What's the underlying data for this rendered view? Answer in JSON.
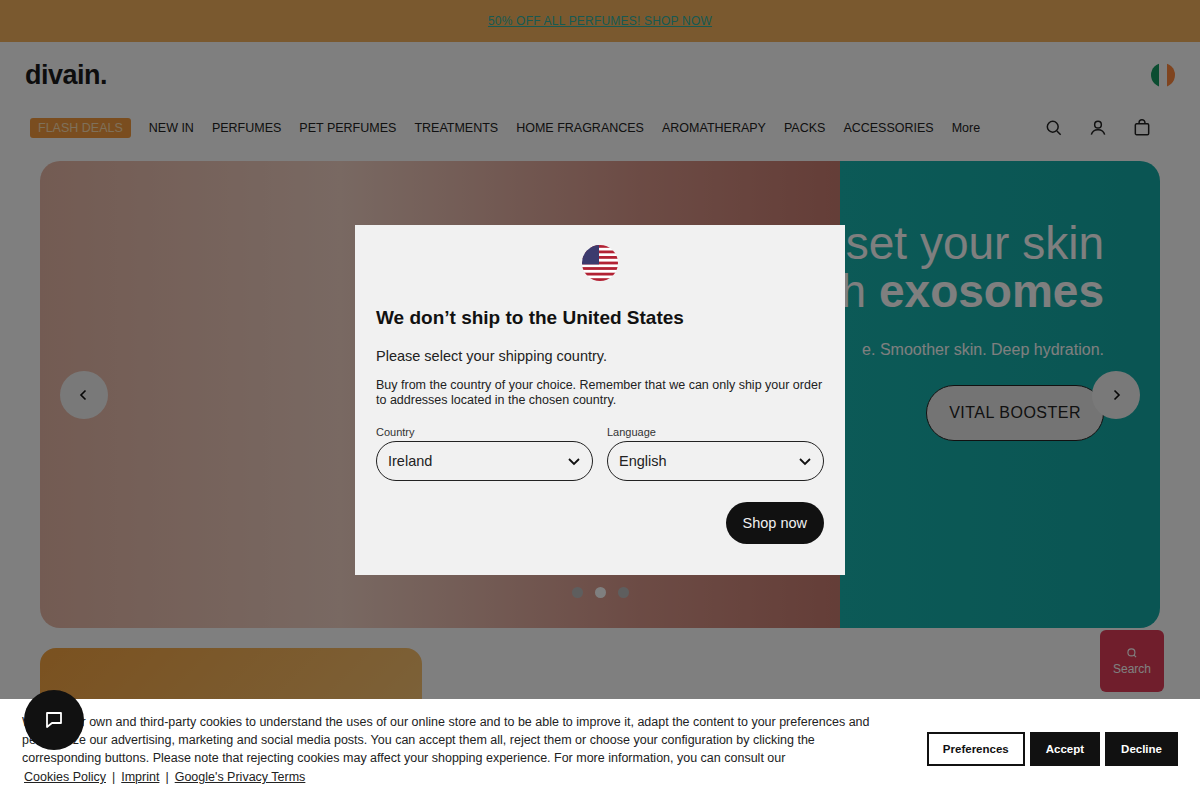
{
  "promo": {
    "text": "50% OFF ALL PERFUMES! SHOP NOW"
  },
  "header": {
    "logo": "divain."
  },
  "nav": {
    "items": [
      {
        "label": "FLASH DEALS",
        "kind": "badge"
      },
      {
        "label": "NEW IN",
        "kind": "link"
      },
      {
        "label": "PERFUMES",
        "kind": "link"
      },
      {
        "label": "PET PERFUMES",
        "kind": "link"
      },
      {
        "label": "TREATMENTS",
        "kind": "link"
      },
      {
        "label": "HOME FRAGRANCES",
        "kind": "link"
      },
      {
        "label": "AROMATHERAPY",
        "kind": "link"
      },
      {
        "label": "PACKS",
        "kind": "link"
      },
      {
        "label": "ACCESSORIES",
        "kind": "link"
      },
      {
        "label": "More",
        "kind": "link"
      }
    ]
  },
  "hero": {
    "title_lines": [
      [
        {
          "text": "set your skin",
          "bold": false
        }
      ],
      [
        {
          "text": "th ",
          "bold": false
        },
        {
          "text": "exosomes",
          "bold": true
        }
      ]
    ],
    "subtitle": "e. Smoother skin. Deep hydration.",
    "button": "VITAL BOOSTER",
    "slides": [
      {
        "selected": false
      },
      {
        "selected": true
      },
      {
        "selected": false
      }
    ]
  },
  "search_fab": {
    "label": "Search"
  },
  "modal": {
    "title": "We don’t ship to the United States",
    "subtitle": "Please select your shipping country.",
    "description": "Buy from the country of your choice. Remember that we can only ship your order to addresses located in the chosen country.",
    "fields": [
      {
        "label": "Country",
        "value": "Ireland"
      },
      {
        "label": "Language",
        "value": "English"
      }
    ],
    "button": "Shop now"
  },
  "cookies": {
    "text": "We use our own and third-party cookies to understand the uses of our online store and to be able to improve it, adapt the content to your preferences and personalize our advertising, marketing and social media posts. You can accept them all, reject them or choose your configuration by clicking the corresponding buttons. Please note that rejecting cookies may affect your shopping experience. For more information, you can consult our",
    "links": [
      "Cookies Policy",
      "Imprint",
      "Google's Privacy Terms"
    ],
    "separator": "|",
    "buttons": [
      {
        "label": "Preferences",
        "kind": "outline"
      },
      {
        "label": "Accept",
        "kind": "solid"
      },
      {
        "label": "Decline",
        "kind": "solid"
      }
    ]
  }
}
